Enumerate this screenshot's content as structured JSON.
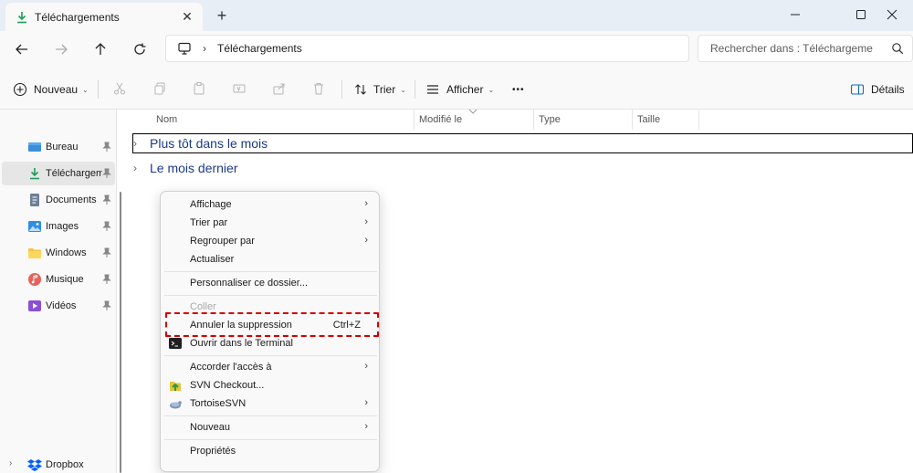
{
  "window": {
    "tab_title": "Téléchargements",
    "close_tab": "✕",
    "new_tab": "+"
  },
  "address": {
    "crumb": "Téléchargements",
    "separator": "›",
    "search_placeholder": "Rechercher dans : Téléchargeme"
  },
  "toolbar": {
    "new_label": "Nouveau",
    "sort_label": "Trier",
    "view_label": "Afficher",
    "more_label": "•••",
    "details_label": "Détails",
    "chevron": "⌄"
  },
  "sidebar": {
    "items": [
      {
        "label": "Bureau",
        "icon": "desktop-icon"
      },
      {
        "label": "Téléchargements",
        "icon": "download-icon"
      },
      {
        "label": "Documents",
        "icon": "documents-icon"
      },
      {
        "label": "Images",
        "icon": "images-icon"
      },
      {
        "label": "Windows",
        "icon": "folder-icon"
      },
      {
        "label": "Musique",
        "icon": "music-icon"
      },
      {
        "label": "Vidéos",
        "icon": "videos-icon"
      }
    ],
    "bottom_item": {
      "label": "Dropbox",
      "icon": "dropbox-icon"
    }
  },
  "columns": [
    "Nom",
    "Modifié le",
    "Type",
    "Taille"
  ],
  "groups": [
    {
      "label": "Plus tôt dans le mois"
    },
    {
      "label": "Le mois dernier"
    }
  ],
  "context_menu": {
    "items": [
      {
        "label": "Affichage",
        "submenu": true
      },
      {
        "label": "Trier par",
        "submenu": true
      },
      {
        "label": "Regrouper par",
        "submenu": true
      },
      {
        "label": "Actualiser"
      },
      {
        "label": "Personnaliser ce dossier..."
      },
      {
        "label": "Coller",
        "disabled": true
      },
      {
        "label": "Annuler la suppression",
        "shortcut": "Ctrl+Z"
      },
      {
        "label": "Ouvrir dans le Terminal",
        "icon": "terminal-icon"
      },
      {
        "label": "Accorder l'accès à",
        "submenu": true
      },
      {
        "label": "SVN Checkout...",
        "icon": "svn-checkout-icon"
      },
      {
        "label": "TortoiseSVN",
        "submenu": true,
        "icon": "tortoisesvn-icon"
      },
      {
        "label": "Nouveau",
        "submenu": true
      },
      {
        "label": "Propriétés"
      }
    ],
    "arrow": "›"
  },
  "colors": {
    "accent": "#0f6cbd",
    "group_text": "#1b3a8a",
    "highlight": "#d40000",
    "download_green": "#1e9e5a"
  }
}
